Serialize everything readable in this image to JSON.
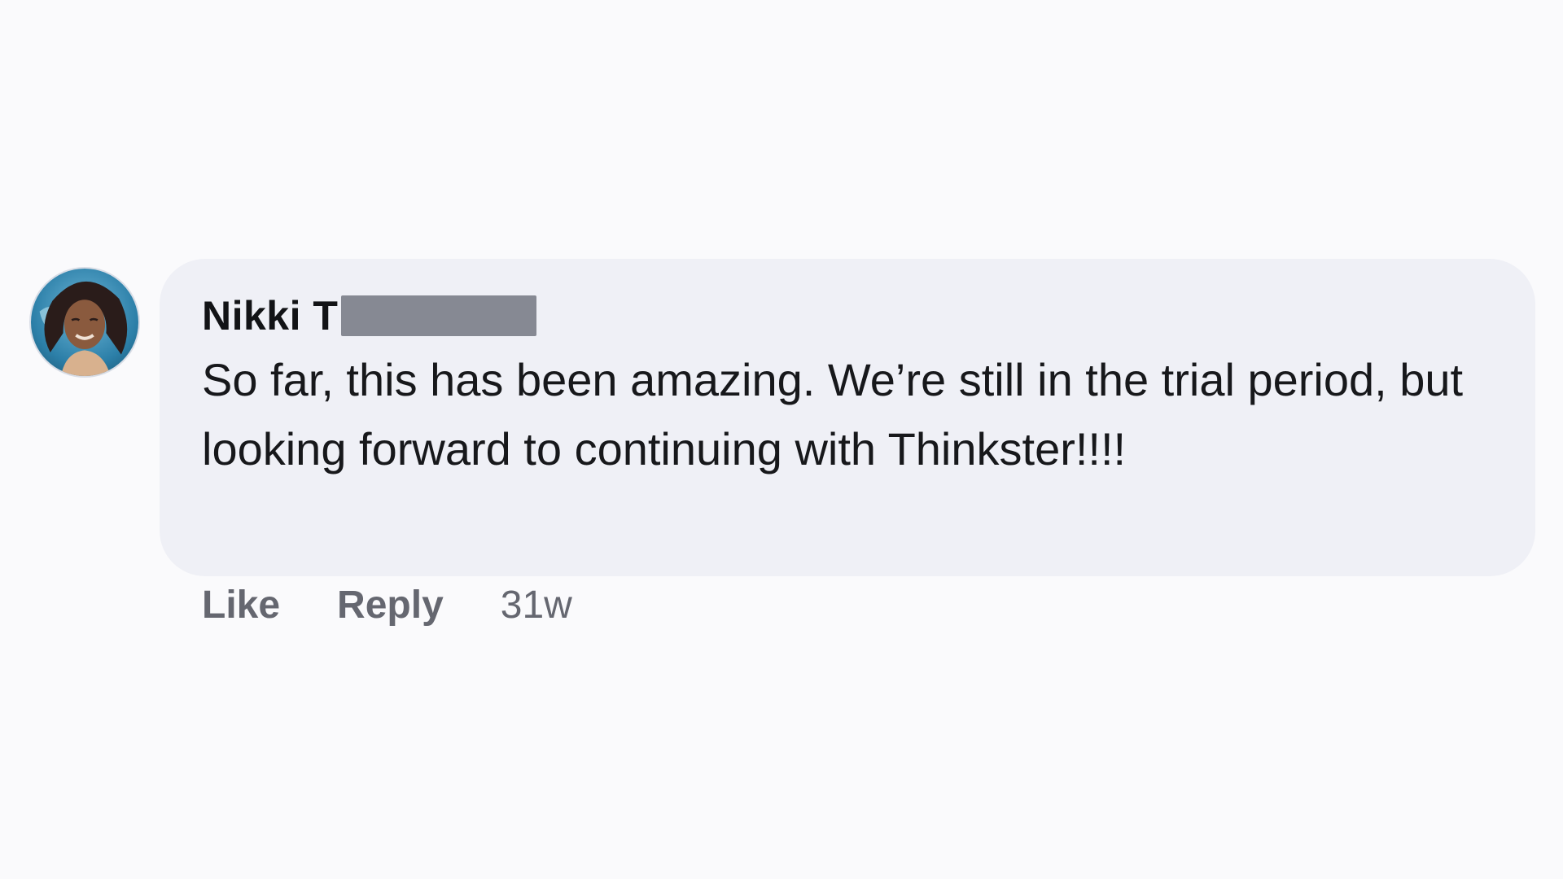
{
  "comment": {
    "author": "Nikki T",
    "text": "So far, this has been amazing. We’re still in the trial period, but looking forward to continuing with Thinkster!!!!",
    "actions": {
      "like_label": "Like",
      "reply_label": "Reply"
    },
    "timestamp": "31w"
  },
  "colors": {
    "background": "#fafafc",
    "bubble": "#eff0f6",
    "author_text": "#121316",
    "body_text": "#17181b",
    "action_text": "#656770",
    "redaction": "#868993"
  },
  "icons": {
    "avatar": "user-avatar-photo"
  }
}
